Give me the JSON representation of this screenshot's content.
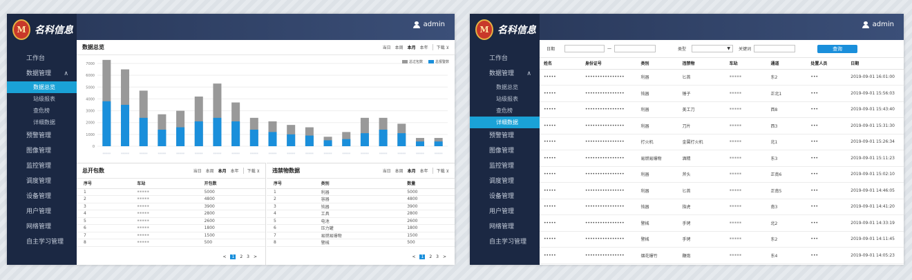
{
  "app": {
    "logo_mark": "M",
    "logo_text": "名科信息",
    "user": "admin"
  },
  "menu_left": [
    {
      "label": "工作台"
    },
    {
      "label": "数据管理",
      "chev": "∧"
    },
    {
      "label": "预警管理"
    },
    {
      "label": "图像管理"
    },
    {
      "label": "监控管理"
    },
    {
      "label": "调度管理"
    },
    {
      "label": "设备管理"
    },
    {
      "label": "用户管理"
    },
    {
      "label": "网络管理"
    },
    {
      "label": "自主学习管理"
    }
  ],
  "submenu": [
    "数据总览",
    "站级报表",
    "查危榜",
    "详细数据"
  ],
  "overview": {
    "title": "数据总览",
    "filters": [
      "当日",
      "本周",
      "本月",
      "本年",
      "下载 ⊻"
    ],
    "active": "本月"
  },
  "colors": {
    "gray": "#999999",
    "blue": "#1a8fdb"
  },
  "chart_data": {
    "type": "bar",
    "stacked": false,
    "ylim": [
      0,
      7000
    ],
    "yticks": [
      0,
      1000,
      2000,
      3000,
      4000,
      5000,
      6000,
      7000
    ],
    "series": [
      {
        "name": "总过包数",
        "color": "#999999",
        "values": [
          7300,
          6500,
          4700,
          2700,
          3000,
          4200,
          5300,
          3700,
          2400,
          2100,
          1800,
          1600,
          800,
          1200,
          2400,
          2400,
          1900,
          700,
          700
        ]
      },
      {
        "name": "总报警数",
        "color": "#1a8fdb",
        "values": [
          3800,
          3500,
          2400,
          1400,
          1600,
          2100,
          2400,
          2100,
          1400,
          1200,
          1000,
          900,
          500,
          600,
          1100,
          1400,
          1100,
          400,
          400
        ]
      }
    ]
  },
  "bags": {
    "title": "总开包数",
    "filters": [
      "当日",
      "本周",
      "本月",
      "本年",
      "下载 ⊻"
    ],
    "headers": [
      "序号",
      "车站",
      "开包数"
    ],
    "rows": [
      [
        "1",
        "•••••",
        "5000"
      ],
      [
        "2",
        "•••••",
        "4800"
      ],
      [
        "3",
        "•••••",
        "3900"
      ],
      [
        "4",
        "•••••",
        "2800"
      ],
      [
        "5",
        "•••••",
        "2600"
      ],
      [
        "6",
        "•••••",
        "1800"
      ],
      [
        "7",
        "•••••",
        "1500"
      ],
      [
        "8",
        "•••••",
        "500"
      ]
    ],
    "pages": [
      "<",
      "1",
      "2",
      "3",
      ">"
    ]
  },
  "contraband": {
    "title": "违禁物数据",
    "filters": [
      "当日",
      "本周",
      "本月",
      "本年",
      "下载 ⊻"
    ],
    "headers": [
      "序号",
      "类别",
      "数量"
    ],
    "rows": [
      [
        "1",
        "利器",
        "5000"
      ],
      [
        "2",
        "容器",
        "4800"
      ],
      [
        "3",
        "钝器",
        "3900"
      ],
      [
        "4",
        "工具",
        "2800"
      ],
      [
        "5",
        "电池",
        "2600"
      ],
      [
        "6",
        "压力罐",
        "1800"
      ],
      [
        "7",
        "易燃易爆物",
        "1500"
      ],
      [
        "8",
        "警械",
        "500"
      ]
    ],
    "pages": [
      "<",
      "1",
      "2",
      "3",
      ">"
    ]
  },
  "search": {
    "date_label": "日期",
    "dash": "一",
    "type_label": "类型",
    "keyword_label": "关键词",
    "query_btn": "查询"
  },
  "detail": {
    "headers": [
      "姓名",
      "身份证号",
      "类别",
      "违禁物",
      "车站",
      "通道",
      "处置人员",
      "日期"
    ],
    "rows": [
      [
        "•••••",
        "••••••••••••••••",
        "利器",
        "匕首",
        "•••••",
        "东2",
        "•••",
        "2019-09-01 16:01:00"
      ],
      [
        "•••••",
        "••••••••••••••••",
        "钝器",
        "锤子",
        "•••••",
        "正北1",
        "•••",
        "2019-09-01 15:56:03"
      ],
      [
        "•••••",
        "••••••••••••••••",
        "利器",
        "美工刀",
        "•••••",
        "西8",
        "•••",
        "2019-09-01 15:43:40"
      ],
      [
        "•••••",
        "••••••••••••••••",
        "利器",
        "刀片",
        "•••••",
        "西3",
        "•••",
        "2019-09-01 15:31:30"
      ],
      [
        "•••••",
        "••••••••••••••••",
        "打火机",
        "金属打火机",
        "•••••",
        "北1",
        "•••",
        "2019-09-01 15:26:34"
      ],
      [
        "•••••",
        "••••••••••••••••",
        "易燃易爆物",
        "酒精",
        "•••••",
        "东3",
        "•••",
        "2019-09-01 15:11:23"
      ],
      [
        "•••••",
        "••••••••••••••••",
        "利器",
        "斧头",
        "•••••",
        "正南6",
        "•••",
        "2019-09-01 15:02:10"
      ],
      [
        "•••••",
        "••••••••••••••••",
        "利器",
        "匕首",
        "•••••",
        "正南5",
        "•••",
        "2019-09-01 14:46:05"
      ],
      [
        "•••••",
        "••••••••••••••••",
        "钝器",
        "指虎",
        "•••••",
        "南3",
        "•••",
        "2019-09-01 14:41:20"
      ],
      [
        "•••••",
        "••••••••••••••••",
        "警械",
        "手铐",
        "•••••",
        "北2",
        "•••",
        "2019-09-01 14:33:19"
      ],
      [
        "•••••",
        "••••••••••••••••",
        "警械",
        "手铐",
        "•••••",
        "东2",
        "•••",
        "2019-09-01 14:11:45"
      ],
      [
        "•••••",
        "••••••••••••••••",
        "烟花爆竹",
        "鞭炮",
        "•••••",
        "东4",
        "•••",
        "2019-09-01 14:05:23"
      ]
    ]
  }
}
